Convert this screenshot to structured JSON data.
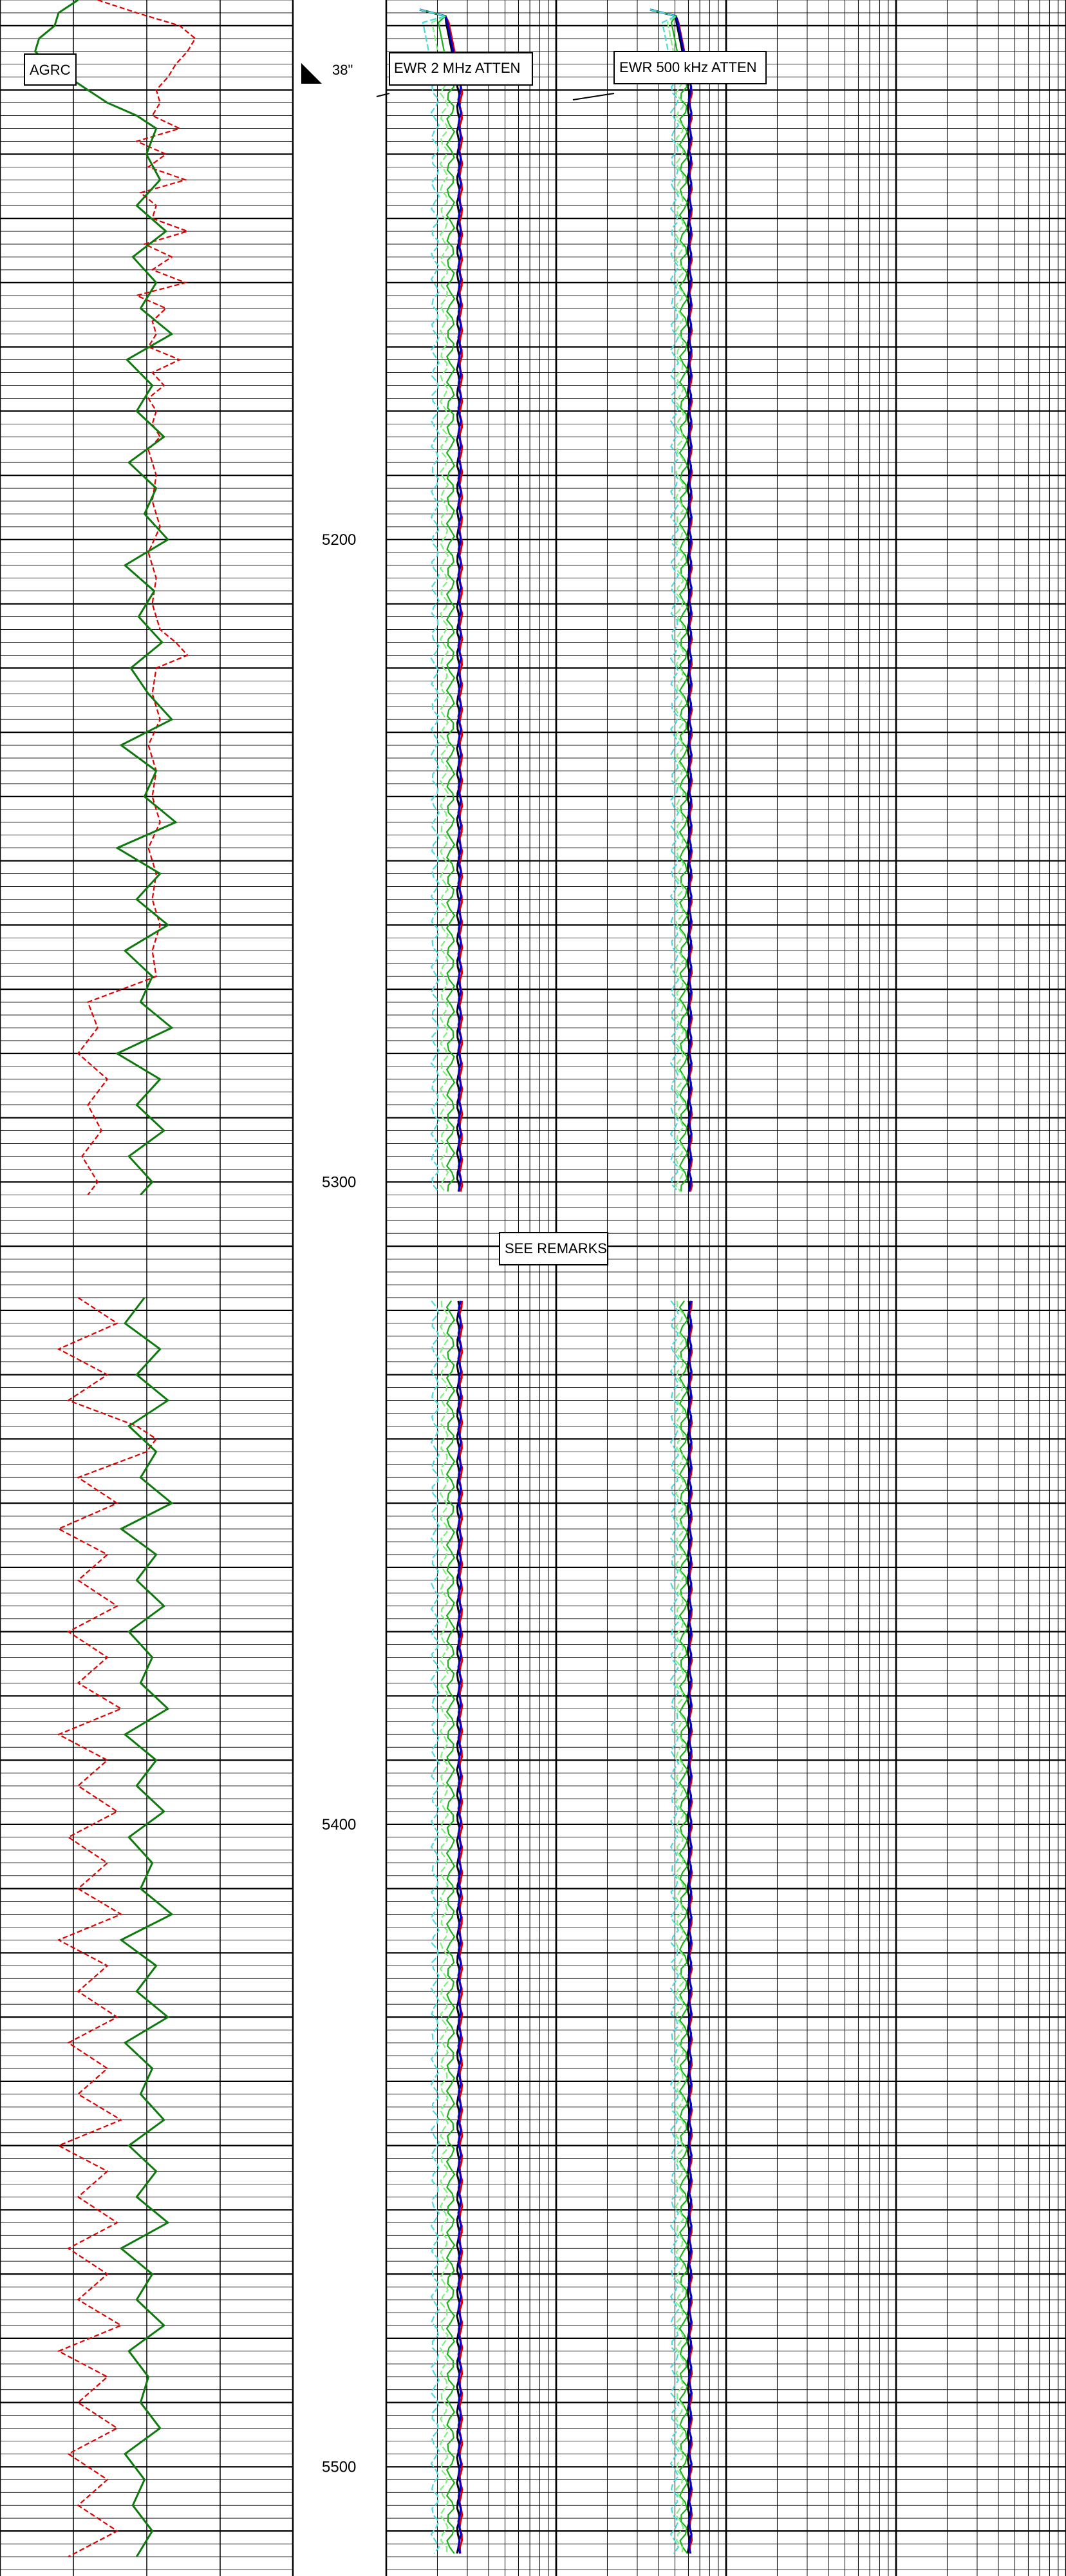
{
  "chart_data": {
    "type": "line",
    "depth_axis": {
      "ticks": [
        5200,
        5300,
        5400,
        5500
      ],
      "range": [
        5116,
        5514
      ]
    },
    "tracks": {
      "left": {
        "curves": [
          {
            "name": "AGRC",
            "color": "#0e7a0e"
          },
          {
            "color": "#e00000",
            "dashed": true
          }
        ]
      },
      "right": {
        "scale": "log",
        "curves_2mhz": {
          "label": "EWR 2 MHz ATTEN"
        },
        "curves_500khz": {
          "label": "EWR 500 kHz ATTEN"
        },
        "colors": [
          "#000000",
          "#e00000",
          "#0000cc",
          "#17b217",
          "#7ff07f",
          "#4dd9d9"
        ]
      }
    },
    "annotations": [
      {
        "text": "AGRC"
      },
      {
        "text": "38\""
      },
      {
        "text": "EWR 2 MHz ATTEN"
      },
      {
        "text": "EWR 500 kHz ATTEN"
      },
      {
        "text": "SEE REMARKS"
      }
    ],
    "data_gaps": [
      [
        5302,
        5318
      ]
    ],
    "agrc_series": [
      [
        5116,
        40
      ],
      [
        5118,
        30
      ],
      [
        5120,
        28
      ],
      [
        5122,
        20
      ],
      [
        5124,
        18
      ],
      [
        5126,
        25
      ],
      [
        5128,
        35
      ],
      [
        5130,
        45
      ],
      [
        5132,
        55
      ],
      [
        5134,
        70
      ],
      [
        5136,
        80
      ],
      [
        5140,
        75
      ],
      [
        5144,
        82
      ],
      [
        5148,
        70
      ],
      [
        5152,
        85
      ],
      [
        5156,
        68
      ],
      [
        5160,
        80
      ],
      [
        5164,
        72
      ],
      [
        5168,
        88
      ],
      [
        5172,
        65
      ],
      [
        5176,
        78
      ],
      [
        5180,
        70
      ],
      [
        5184,
        84
      ],
      [
        5188,
        66
      ],
      [
        5192,
        80
      ],
      [
        5196,
        74
      ],
      [
        5200,
        86
      ],
      [
        5204,
        64
      ],
      [
        5208,
        79
      ],
      [
        5212,
        71
      ],
      [
        5216,
        83
      ],
      [
        5220,
        67
      ],
      [
        5224,
        76
      ],
      [
        5228,
        88
      ],
      [
        5232,
        62
      ],
      [
        5236,
        80
      ],
      [
        5240,
        74
      ],
      [
        5244,
        90
      ],
      [
        5248,
        60
      ],
      [
        5252,
        82
      ],
      [
        5256,
        70
      ],
      [
        5260,
        86
      ],
      [
        5264,
        64
      ],
      [
        5268,
        78
      ],
      [
        5272,
        72
      ],
      [
        5276,
        88
      ],
      [
        5280,
        60
      ],
      [
        5284,
        82
      ],
      [
        5288,
        70
      ],
      [
        5292,
        84
      ],
      [
        5296,
        66
      ],
      [
        5300,
        78
      ],
      [
        5302,
        72
      ],
      [
        5318,
        74
      ],
      [
        5322,
        64
      ],
      [
        5326,
        82
      ],
      [
        5330,
        70
      ],
      [
        5334,
        86
      ],
      [
        5338,
        66
      ],
      [
        5342,
        80
      ],
      [
        5346,
        72
      ],
      [
        5350,
        88
      ],
      [
        5354,
        62
      ],
      [
        5358,
        80
      ],
      [
        5362,
        70
      ],
      [
        5366,
        84
      ],
      [
        5370,
        66
      ],
      [
        5374,
        78
      ],
      [
        5378,
        72
      ],
      [
        5382,
        86
      ],
      [
        5386,
        64
      ],
      [
        5390,
        80
      ],
      [
        5394,
        70
      ],
      [
        5398,
        84
      ],
      [
        5402,
        66
      ],
      [
        5406,
        78
      ],
      [
        5410,
        72
      ],
      [
        5414,
        88
      ],
      [
        5418,
        62
      ],
      [
        5422,
        80
      ],
      [
        5426,
        70
      ],
      [
        5430,
        86
      ],
      [
        5434,
        64
      ],
      [
        5438,
        78
      ],
      [
        5442,
        72
      ],
      [
        5446,
        84
      ],
      [
        5450,
        66
      ],
      [
        5454,
        80
      ],
      [
        5458,
        70
      ],
      [
        5462,
        86
      ],
      [
        5466,
        62
      ],
      [
        5470,
        78
      ],
      [
        5474,
        70
      ],
      [
        5478,
        84
      ],
      [
        5482,
        66
      ],
      [
        5486,
        76
      ],
      [
        5490,
        72
      ],
      [
        5494,
        82
      ],
      [
        5498,
        64
      ],
      [
        5502,
        74
      ],
      [
        5506,
        68
      ],
      [
        5510,
        78
      ],
      [
        5514,
        70
      ]
    ],
    "red_series": [
      [
        5116,
        50
      ],
      [
        5118,
        70
      ],
      [
        5120,
        92
      ],
      [
        5122,
        100
      ],
      [
        5124,
        96
      ],
      [
        5126,
        90
      ],
      [
        5128,
        86
      ],
      [
        5130,
        80
      ],
      [
        5132,
        82
      ],
      [
        5134,
        78
      ],
      [
        5136,
        92
      ],
      [
        5138,
        70
      ],
      [
        5140,
        85
      ],
      [
        5142,
        76
      ],
      [
        5144,
        95
      ],
      [
        5146,
        72
      ],
      [
        5148,
        80
      ],
      [
        5150,
        78
      ],
      [
        5152,
        96
      ],
      [
        5154,
        74
      ],
      [
        5156,
        88
      ],
      [
        5158,
        78
      ],
      [
        5160,
        95
      ],
      [
        5162,
        70
      ],
      [
        5164,
        85
      ],
      [
        5166,
        78
      ],
      [
        5168,
        80
      ],
      [
        5170,
        76
      ],
      [
        5172,
        92
      ],
      [
        5174,
        78
      ],
      [
        5176,
        84
      ],
      [
        5178,
        76
      ],
      [
        5180,
        80
      ],
      [
        5182,
        78
      ],
      [
        5184,
        82
      ],
      [
        5186,
        76
      ],
      [
        5190,
        80
      ],
      [
        5194,
        78
      ],
      [
        5198,
        82
      ],
      [
        5202,
        76
      ],
      [
        5206,
        80
      ],
      [
        5210,
        78
      ],
      [
        5214,
        82
      ],
      [
        5216,
        90
      ],
      [
        5218,
        96
      ],
      [
        5220,
        80
      ],
      [
        5224,
        78
      ],
      [
        5228,
        82
      ],
      [
        5232,
        76
      ],
      [
        5236,
        80
      ],
      [
        5240,
        78
      ],
      [
        5244,
        82
      ],
      [
        5248,
        76
      ],
      [
        5252,
        80
      ],
      [
        5256,
        78
      ],
      [
        5260,
        82
      ],
      [
        5264,
        78
      ],
      [
        5268,
        80
      ],
      [
        5272,
        45
      ],
      [
        5276,
        50
      ],
      [
        5280,
        40
      ],
      [
        5284,
        55
      ],
      [
        5288,
        45
      ],
      [
        5292,
        52
      ],
      [
        5296,
        42
      ],
      [
        5300,
        50
      ],
      [
        5302,
        45
      ],
      [
        5318,
        40
      ],
      [
        5322,
        60
      ],
      [
        5326,
        30
      ],
      [
        5330,
        55
      ],
      [
        5334,
        35
      ],
      [
        5338,
        70
      ],
      [
        5340,
        80
      ],
      [
        5342,
        75
      ],
      [
        5346,
        40
      ],
      [
        5350,
        60
      ],
      [
        5354,
        30
      ],
      [
        5358,
        55
      ],
      [
        5362,
        40
      ],
      [
        5366,
        60
      ],
      [
        5370,
        35
      ],
      [
        5374,
        55
      ],
      [
        5378,
        40
      ],
      [
        5382,
        62
      ],
      [
        5386,
        30
      ],
      [
        5390,
        55
      ],
      [
        5394,
        40
      ],
      [
        5398,
        60
      ],
      [
        5402,
        35
      ],
      [
        5406,
        55
      ],
      [
        5410,
        40
      ],
      [
        5414,
        62
      ],
      [
        5418,
        30
      ],
      [
        5422,
        55
      ],
      [
        5426,
        40
      ],
      [
        5430,
        60
      ],
      [
        5434,
        35
      ],
      [
        5438,
        55
      ],
      [
        5442,
        40
      ],
      [
        5446,
        62
      ],
      [
        5450,
        30
      ],
      [
        5454,
        55
      ],
      [
        5458,
        40
      ],
      [
        5462,
        60
      ],
      [
        5466,
        35
      ],
      [
        5470,
        55
      ],
      [
        5474,
        40
      ],
      [
        5478,
        62
      ],
      [
        5482,
        30
      ],
      [
        5486,
        55
      ],
      [
        5490,
        40
      ],
      [
        5494,
        60
      ],
      [
        5498,
        35
      ],
      [
        5502,
        55
      ],
      [
        5506,
        40
      ],
      [
        5510,
        60
      ],
      [
        5514,
        35
      ]
    ]
  }
}
